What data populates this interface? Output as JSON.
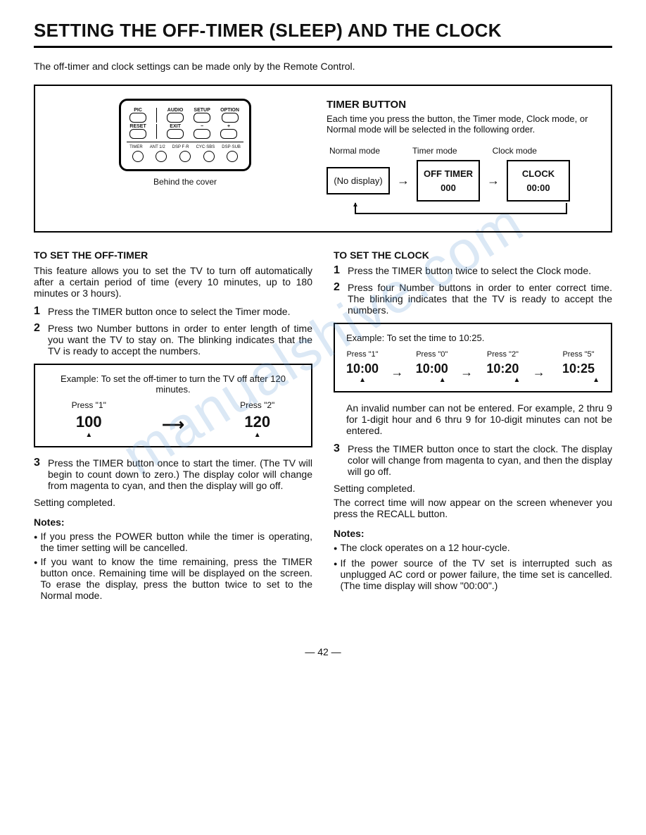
{
  "title": "SETTING THE OFF-TIMER (SLEEP) AND THE CLOCK",
  "intro": "The off-timer and clock settings can be made only by the Remote Control.",
  "remote": {
    "row1": [
      "PIC",
      "AUDIO",
      "SETUP",
      "OPTION"
    ],
    "row2": [
      "RESET",
      "EXIT",
      "−",
      "+"
    ],
    "row3": [
      "TIMER",
      "ANT 1/2",
      "DSP F·R",
      "CYC·SBS",
      "DSP·SUB"
    ],
    "caption": "Behind the cover"
  },
  "timer_button": {
    "heading": "TIMER BUTTON",
    "desc": "Each time you press the button, the Timer mode, Clock mode, or Normal mode will be selected in the following order.",
    "modes": {
      "labels": [
        "Normal mode",
        "Timer mode",
        "Clock mode"
      ],
      "boxes": [
        "(No display)",
        "OFF TIMER\n000",
        "CLOCK\n00:00"
      ]
    }
  },
  "left": {
    "heading": "TO SET THE OFF-TIMER",
    "intro": "This feature allows you to set the TV to turn off automatically after a certain period of time (every 10 minutes, up to 180 minutes or 3 hours).",
    "steps": [
      "Press the TIMER button once to select the Timer mode.",
      "Press two Number buttons in order to enter length of time you want the TV to stay on. The blinking indicates that the TV is ready to accept the numbers."
    ],
    "example": {
      "title": "Example: To set the off-timer to turn the TV off after 120 minutes.",
      "press": [
        "Press \"1\"",
        "Press \"2\""
      ],
      "values": [
        "100",
        "120"
      ]
    },
    "step3": "Press the TIMER button once to start the timer. (The TV will begin to count down to zero.) The display color will change from magenta to cyan, and then the display will go off.",
    "done": "Setting completed.",
    "notes_heading": "Notes:",
    "notes": [
      "If you press the POWER button while the timer is operating, the timer setting will be cancelled.",
      "If you want to know the time remaining, press the TIMER button once. Remaining time will be displayed on the screen. To erase the display, press the button twice to set to the Normal mode."
    ]
  },
  "right": {
    "heading": "TO SET THE CLOCK",
    "steps": [
      "Press the TIMER button twice to select the Clock mode.",
      "Press four Number buttons in order to enter correct time. The blinking indicates that the TV is ready to accept the numbers."
    ],
    "example": {
      "title": "Example: To set the time to 10:25.",
      "press": [
        "Press \"1\"",
        "Press \"0\"",
        "Press \"2\"",
        "Press \"5\""
      ],
      "values": [
        "10:00",
        "10:00",
        "10:20",
        "10:25"
      ]
    },
    "invalid": "An invalid number can not be entered. For example, 2 thru 9 for 1-digit hour and 6 thru 9 for 10-digit minutes can not be entered.",
    "step3": "Press the TIMER button once to start the clock. The display color will change from magenta to cyan, and then the display will go off.",
    "done": "Setting completed.",
    "done2": "The correct time will now appear on the screen whenever you press the RECALL button.",
    "notes_heading": "Notes:",
    "notes": [
      "The clock operates on a 12 hour-cycle.",
      "If the power source of the TV set is interrupted such as unplugged AC cord or power failure, the time set is cancelled. (The time display will show \"00:00\".)"
    ]
  },
  "watermark": "manualshive.com",
  "page_number": "— 42 —"
}
